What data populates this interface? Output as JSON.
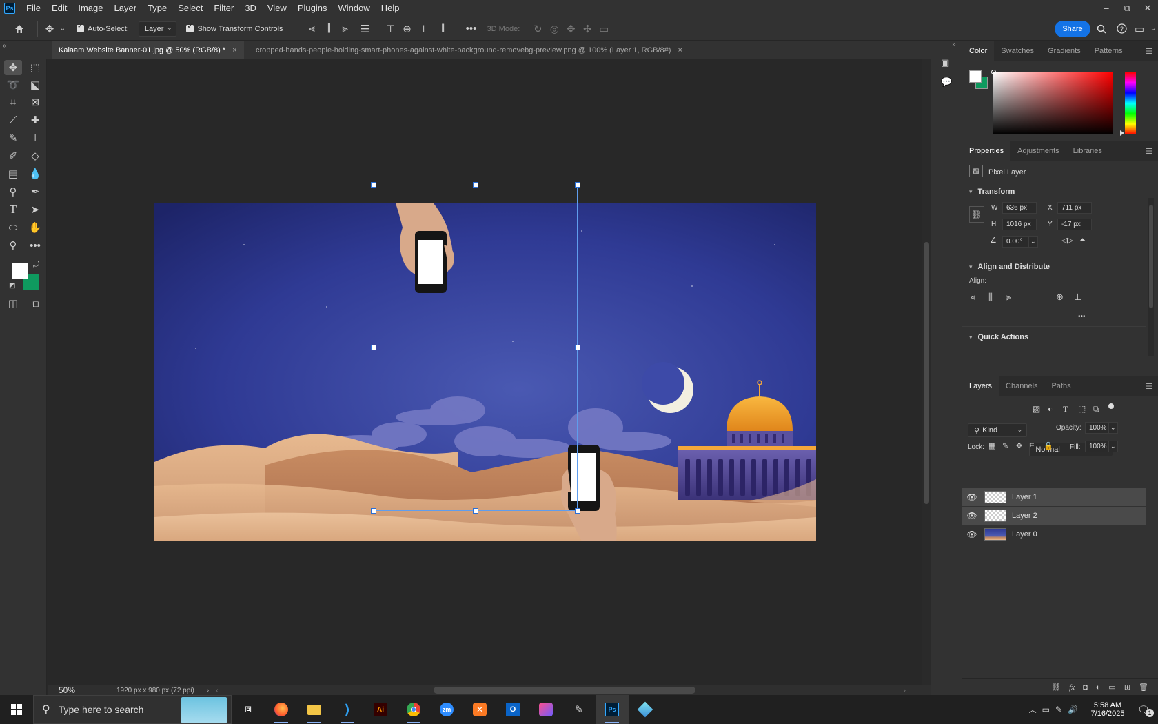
{
  "app": {
    "logo": "Ps"
  },
  "menu": [
    "File",
    "Edit",
    "Image",
    "Layer",
    "Type",
    "Select",
    "Filter",
    "3D",
    "View",
    "Plugins",
    "Window",
    "Help"
  ],
  "window_controls": {
    "minimize": "–",
    "restore": "⧉",
    "close": "✕"
  },
  "options": {
    "auto_select_label": "Auto-Select:",
    "auto_select_target": "Layer",
    "show_transform_label": "Show Transform Controls",
    "three_d_mode_label": "3D Mode:",
    "share_label": "Share"
  },
  "tabs": [
    {
      "label": "Kalaam Website Banner-01.jpg @ 50% (RGB/8) *",
      "active": true
    },
    {
      "label": "cropped-hands-people-holding-smart-phones-against-white-background-removebg-preview.png @ 100% (Layer 1, RGB/8#)",
      "active": false
    }
  ],
  "tab_close": "×",
  "status": {
    "zoom": "50%",
    "doc_info": "1920 px x 980 px (72 ppi)"
  },
  "colors": {
    "foreground": "#ffffff",
    "background": "#0f9a5f",
    "accent": "#1473e6"
  },
  "color_panel": {
    "tabs": [
      "Color",
      "Swatches",
      "Gradients",
      "Patterns"
    ]
  },
  "properties_panel": {
    "tabs": [
      "Properties",
      "Adjustments",
      "Libraries"
    ],
    "layer_type": "Pixel Layer",
    "transform_title": "Transform",
    "w_label": "W",
    "w_value": "636 px",
    "h_label": "H",
    "h_value": "1016 px",
    "x_label": "X",
    "x_value": "711 px",
    "y_label": "Y",
    "y_value": "-17 px",
    "angle_value": "0.00°",
    "align_title": "Align and Distribute",
    "align_label": "Align:",
    "quick_actions_title": "Quick Actions",
    "more": "•••"
  },
  "layers_panel": {
    "tabs": [
      "Layers",
      "Channels",
      "Paths"
    ],
    "filter_label": "Kind",
    "blend_mode": "Normal",
    "opacity_label": "Opacity:",
    "opacity_value": "100%",
    "lock_label": "Lock:",
    "fill_label": "Fill:",
    "fill_value": "100%",
    "layers": [
      {
        "name": "Layer 1",
        "selected": true
      },
      {
        "name": "Layer 2",
        "selected": true
      },
      {
        "name": "Layer 0",
        "selected": false
      }
    ]
  },
  "taskbar": {
    "search_placeholder": "Type here to search",
    "time": "5:58 AM",
    "date": "7/16/2025",
    "notification_count": "1"
  }
}
